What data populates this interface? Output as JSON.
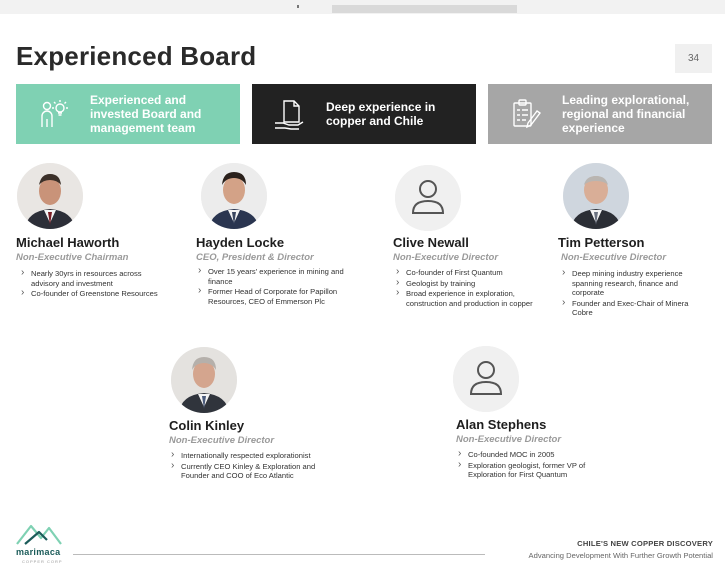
{
  "page": {
    "title": "Experienced Board",
    "page_number": "34"
  },
  "banners": [
    {
      "text": "Experienced and invested Board and management team",
      "color": "#7fd1b3",
      "icon": "people-idea-icon"
    },
    {
      "text": "Deep experience in copper and Chile",
      "color": "#222222",
      "icon": "hand-document-icon"
    },
    {
      "text": "Leading explorational, regional and financial experience",
      "color": "#a6a6a6",
      "icon": "clipboard-pencil-icon"
    }
  ],
  "people": [
    {
      "name": "Michael Haworth",
      "role": "Non-Executive Chairman",
      "bullets": [
        "Nearly 30yrs in resources across advisory and investment",
        "Co-founder of Greenstone Resources"
      ]
    },
    {
      "name": "Hayden Locke",
      "role": "CEO, President & Director",
      "bullets": [
        "Over 15 years' experience in mining and finance",
        "Former Head of Corporate for Papillon Resources, CEO of Emmerson Plc"
      ]
    },
    {
      "name": "Clive Newall",
      "role": "Non-Executive Director",
      "bullets": [
        "Co-founder of First Quantum",
        "Geologist by training",
        "Broad experience in exploration, construction and production in copper"
      ]
    },
    {
      "name": "Tim Petterson",
      "role": "Non-Executive Director",
      "bullets": [
        "Deep mining industry experience spanning research, finance and corporate",
        "Founder and Exec-Chair of Minera Cobre"
      ]
    },
    {
      "name": "Colin Kinley",
      "role": "Non-Executive Director",
      "bullets": [
        "Internationally respected explorationist",
        "Currently CEO Kinley & Exploration and Founder and COO of Eco Atlantic"
      ]
    },
    {
      "name": "Alan Stephens",
      "role": "Non-Executive Director",
      "bullets": [
        "Co-founded MOC in 2005",
        "Exploration geologist, former VP of Exploration for First Quantum"
      ]
    }
  ],
  "footer": {
    "logo_text": "marimaca",
    "logo_subtext": "COPPER CORP",
    "tagline_title": "CHILE'S NEW COPPER DISCOVERY",
    "tagline_sub": "Advancing Development With Further Growth Potential"
  },
  "colors": {
    "green_accent": "#7fd1b3",
    "dark": "#222222",
    "grey": "#a6a6a6",
    "logo_teal": "#1c5c5a"
  }
}
